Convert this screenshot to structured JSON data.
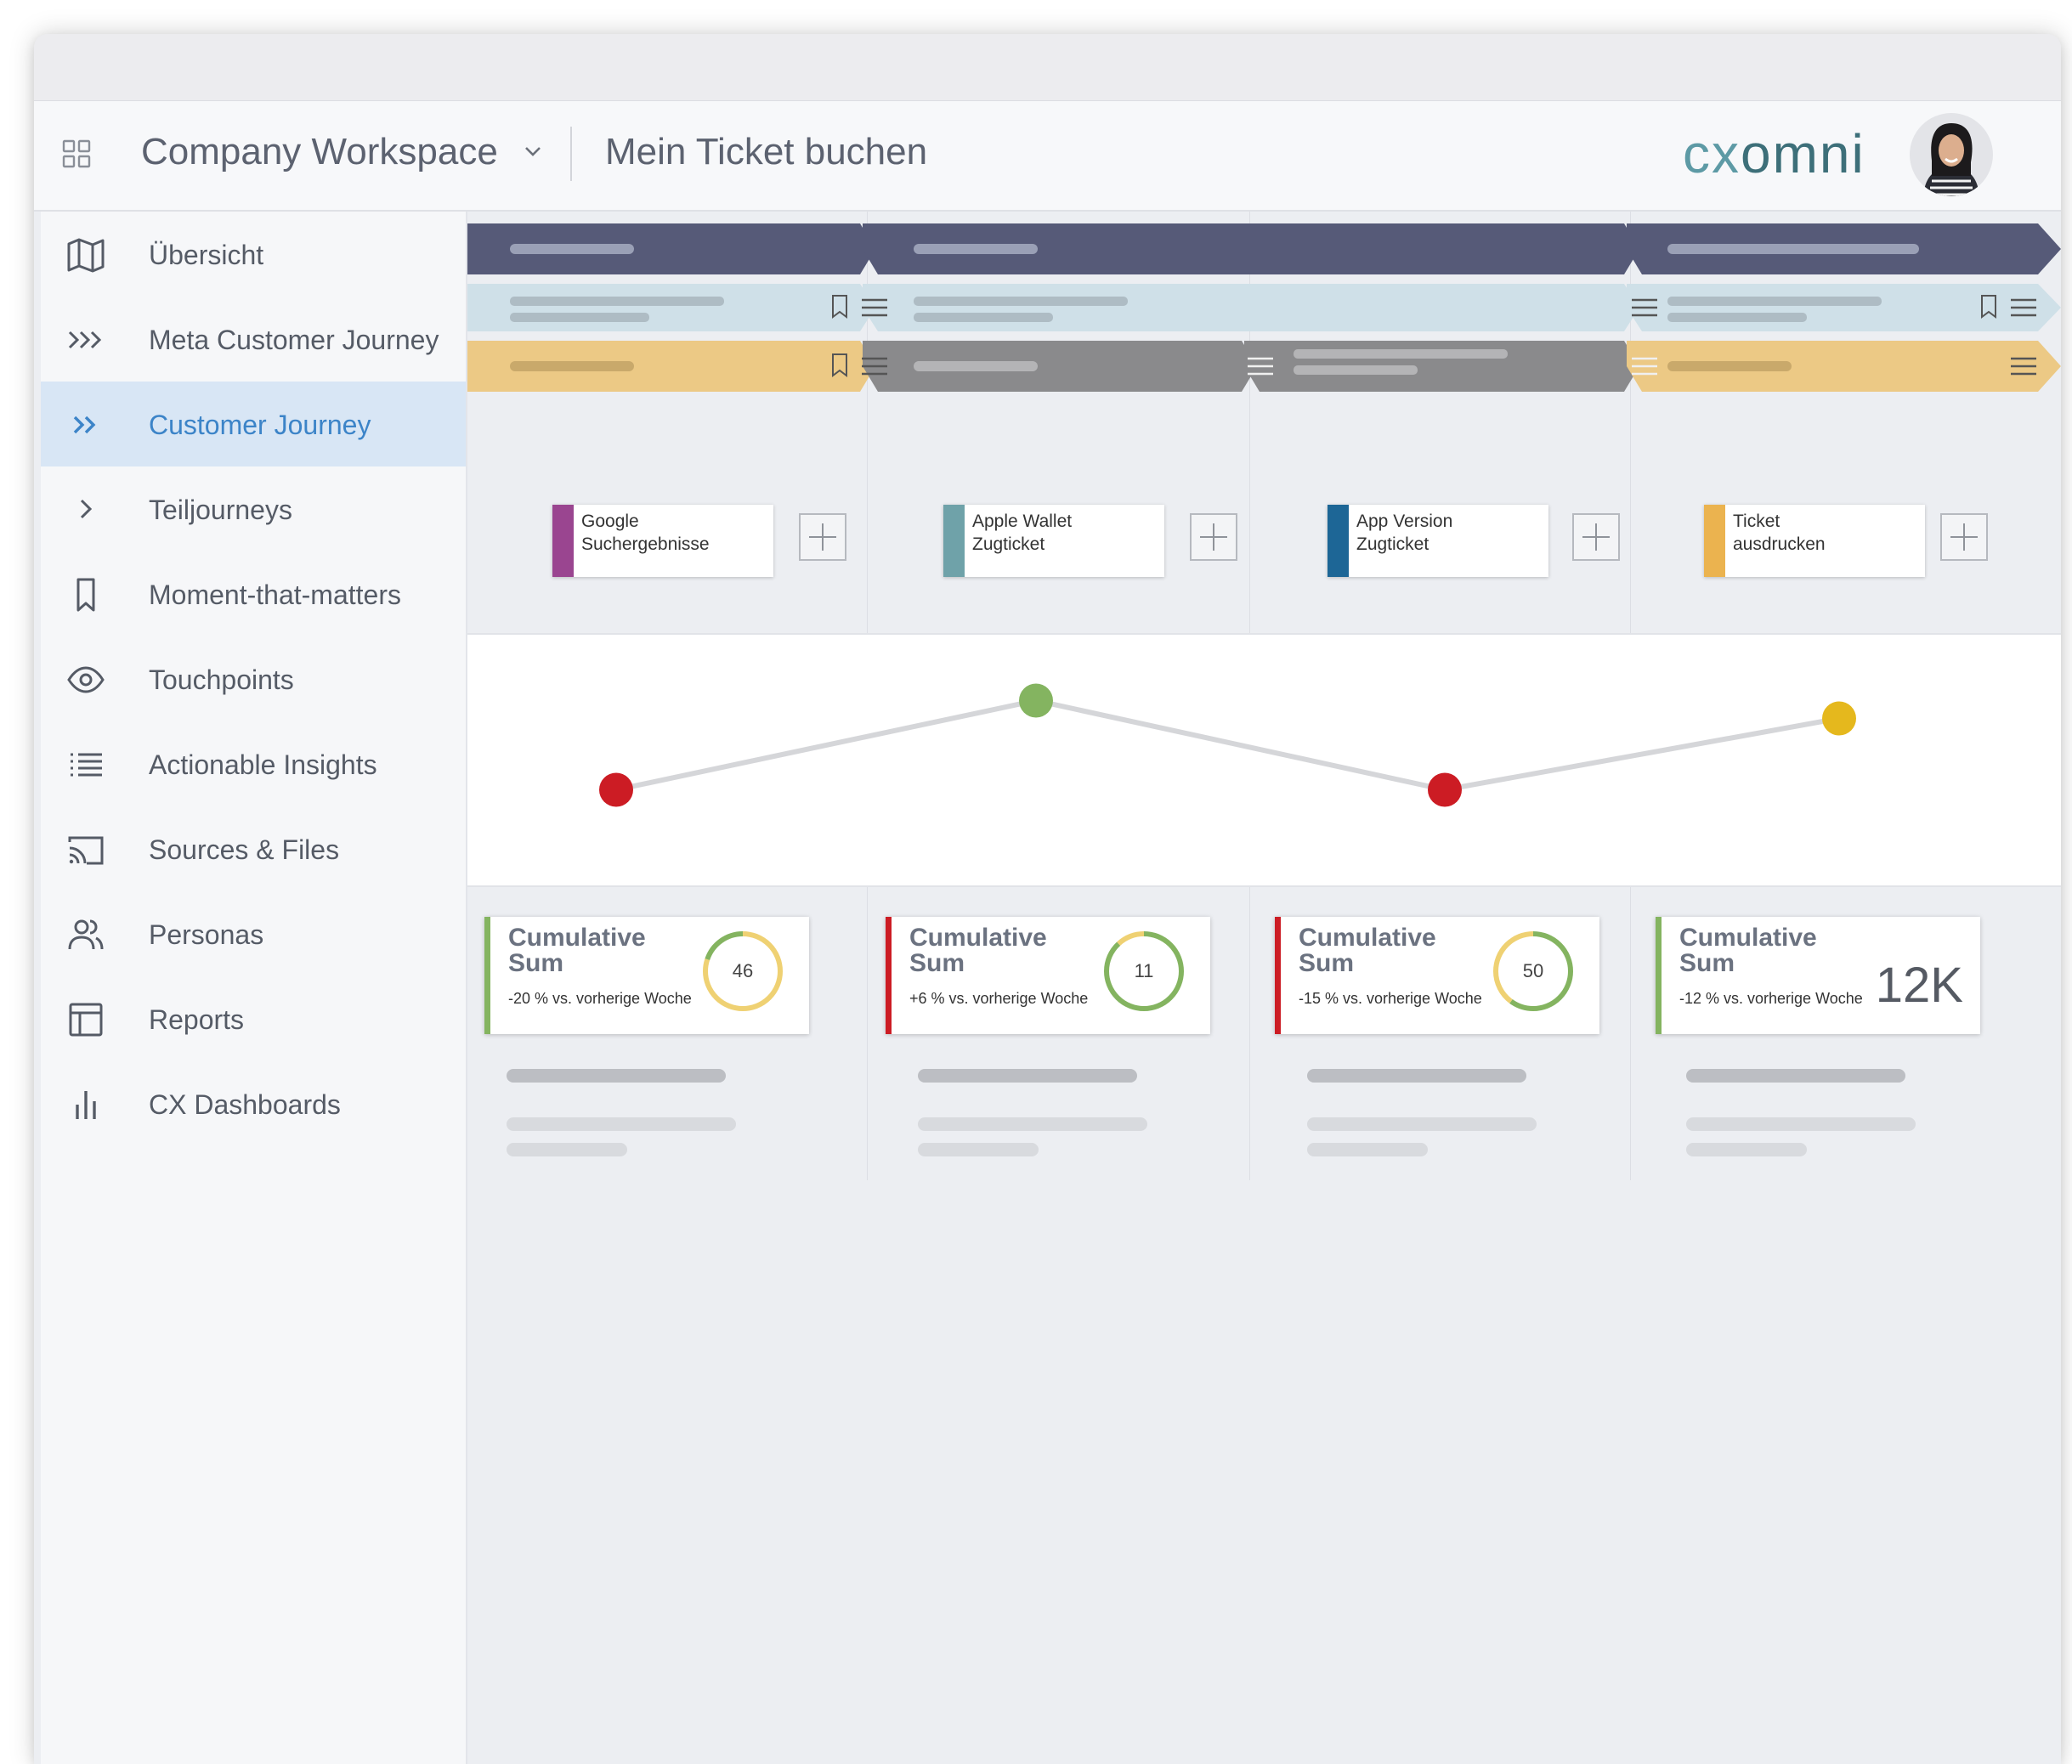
{
  "header": {
    "workspace": "Company Workspace",
    "page_title": "Mein Ticket buchen",
    "logo_prefix": "cx",
    "logo_suffix": "omni"
  },
  "sidebar": {
    "items": [
      {
        "label": "Übersicht",
        "icon": "map-icon",
        "active": false
      },
      {
        "label": "Meta Customer Journey",
        "icon": "triple-chevron-icon",
        "active": false
      },
      {
        "label": "Customer Journey",
        "icon": "double-chevron-icon",
        "active": true
      },
      {
        "label": "Teiljourneys",
        "icon": "chevron-right-icon",
        "active": false
      },
      {
        "label": "Moment-that-matters",
        "icon": "bookmark-icon",
        "active": false
      },
      {
        "label": "Touchpoints",
        "icon": "eye-icon",
        "active": false
      },
      {
        "label": "Actionable Insights",
        "icon": "list-icon",
        "active": false
      },
      {
        "label": "Sources & Files",
        "icon": "cast-icon",
        "active": false
      },
      {
        "label": "Personas",
        "icon": "users-icon",
        "active": false
      },
      {
        "label": "Reports",
        "icon": "table-icon",
        "active": false
      },
      {
        "label": "CX Dashboards",
        "icon": "bar-chart-icon",
        "active": false
      }
    ]
  },
  "colors": {
    "accent": "#3c84c8",
    "stage_row": "#565a78",
    "sub_row": "#cfe0e8",
    "moment_row_yellow": "#ecc985",
    "moment_row_gray": "#8a8a8c",
    "red": "#cc1c24",
    "green": "#84b460",
    "yellow": "#e5b81d"
  },
  "touchpoints": [
    {
      "label": "Google\nSuchergebnisse",
      "color": "#9a4590"
    },
    {
      "label": "Apple Wallet\nZugticket",
      "color": "#6fa2a9"
    },
    {
      "label": "App Version\nZugticket",
      "color": "#1d6696"
    },
    {
      "label": "Ticket\nausdrucken",
      "color": "#ebb34f"
    }
  ],
  "chart_data": {
    "type": "line",
    "categories": [
      "Google Suchergebnisse",
      "Apple Wallet Zugticket",
      "App Version Zugticket",
      "Ticket ausdrucken"
    ],
    "series": [
      {
        "values": [
          1,
          3,
          1,
          2.6
        ],
        "point_colors": [
          "#cc1c24",
          "#84b460",
          "#cc1c24",
          "#e5b81d"
        ]
      }
    ],
    "ylim": [
      0,
      4
    ],
    "axes_visible": false,
    "grid": false
  },
  "kpis": [
    {
      "title": "Cumulative\nSum",
      "subtitle": "-20 % vs. vorherige Woche",
      "value": "46",
      "accent": "#84b460",
      "ring": [
        {
          "color": "#efd173",
          "fraction": 0.8
        },
        {
          "color": "#84b460",
          "fraction": 0.2
        }
      ]
    },
    {
      "title": "Cumulative\nSum",
      "subtitle": "+6 % vs. vorherige Woche",
      "value": "11",
      "accent": "#cc1c24",
      "ring": [
        {
          "color": "#84b460",
          "fraction": 0.88
        },
        {
          "color": "#efd173",
          "fraction": 0.12
        }
      ]
    },
    {
      "title": "Cumulative\nSum",
      "subtitle": "-15 % vs. vorherige Woche",
      "value": "50",
      "accent": "#cc1c24",
      "ring": [
        {
          "color": "#84b460",
          "fraction": 0.6
        },
        {
          "color": "#efd173",
          "fraction": 0.4
        }
      ]
    },
    {
      "title": "Cumulative\nSum",
      "subtitle": "-12 % vs. vorherige Woche",
      "value": "12K",
      "accent": "#84b460",
      "ring": []
    }
  ]
}
